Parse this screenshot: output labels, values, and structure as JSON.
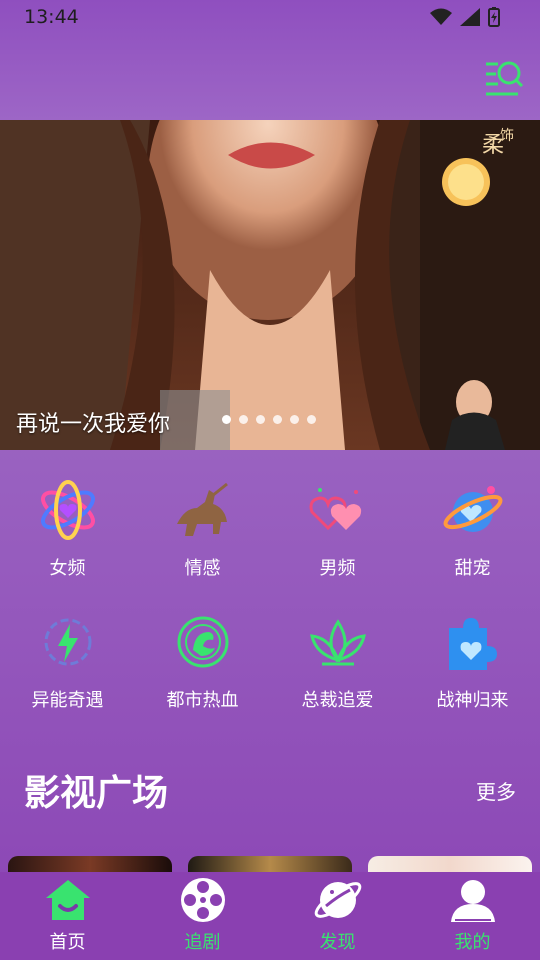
{
  "status": {
    "time": "13:44"
  },
  "banner": {
    "title": "再说一次我爱你",
    "poster_text": "柔",
    "poster_text_2": "饰",
    "slide_count": 6,
    "active_slide": 0
  },
  "categories": [
    {
      "label": "女频",
      "icon": "atom-heart-icon"
    },
    {
      "label": "情感",
      "icon": "horse-rider-icon"
    },
    {
      "label": "男频",
      "icon": "double-heart-icon"
    },
    {
      "label": "甜宠",
      "icon": "planet-heart-icon"
    },
    {
      "label": "异能奇遇",
      "icon": "lightning-gear-icon"
    },
    {
      "label": "都市热血",
      "icon": "dragon-emblem-icon"
    },
    {
      "label": "总裁追爱",
      "icon": "lotus-icon"
    },
    {
      "label": "战神归来",
      "icon": "heart-puzzle-icon"
    }
  ],
  "section": {
    "title": "影视广场",
    "more": "更多"
  },
  "nav": [
    {
      "label": "首页",
      "icon": "home-icon",
      "active": true,
      "color": "#ffffff"
    },
    {
      "label": "追剧",
      "icon": "film-reel-icon",
      "active": false,
      "color": "#39e36f"
    },
    {
      "label": "发现",
      "icon": "planet-icon",
      "active": false,
      "color": "#39e36f"
    },
    {
      "label": "我的",
      "icon": "user-icon",
      "active": false,
      "color": "#39e36f"
    }
  ],
  "colors": {
    "accent": "#39e36f",
    "header": "#9055c0",
    "nav_bg": "#8a40b1"
  }
}
